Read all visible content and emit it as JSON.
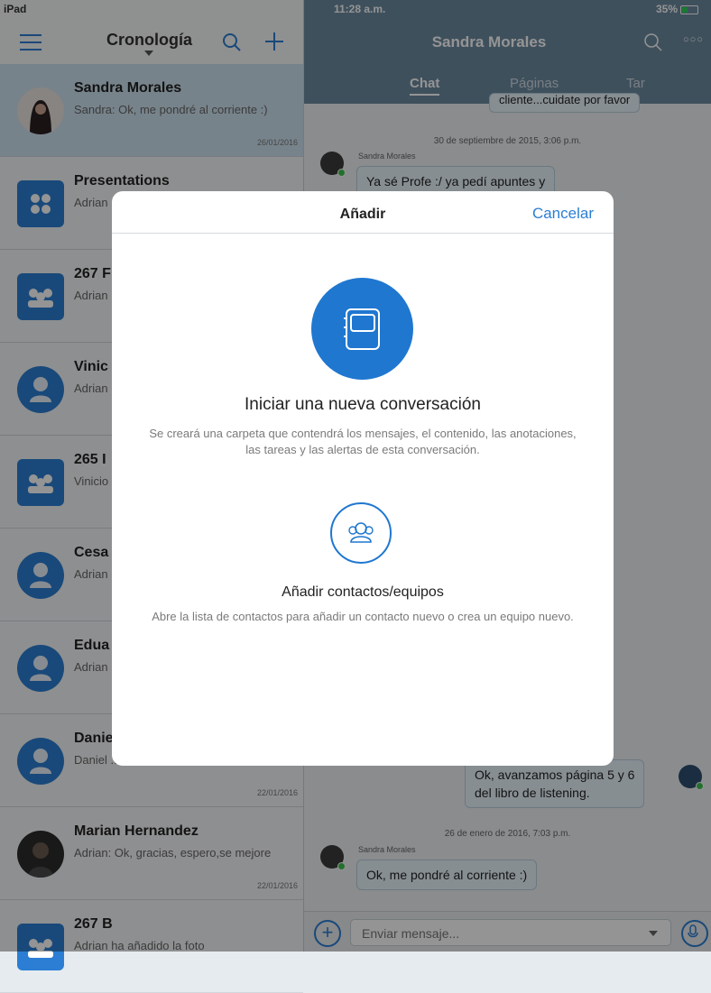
{
  "status_bar": {
    "device": "iPad",
    "time": "11:28 a.m.",
    "battery": "35%"
  },
  "left_pane": {
    "title": "Cronología",
    "items": [
      {
        "title": "Sandra Morales",
        "text": "Sandra: Ok, me pondré al corriente :)",
        "date": "26/01/2016"
      },
      {
        "title": "Presentations",
        "text": "Adrian ... \"26/01...",
        "date": ""
      },
      {
        "title": "267 F",
        "text": "Adrian ... archiv...",
        "date": ""
      },
      {
        "title": "Vinic",
        "text": "Adrian ...",
        "date": ""
      },
      {
        "title": "265 I",
        "text": "Vinicio ... no lleg...",
        "date": ""
      },
      {
        "title": "Cesa",
        "text": "Adrian ...",
        "date": ""
      },
      {
        "title": "Edua",
        "text": "Adrian ... tienes...",
        "date": ""
      },
      {
        "title": "Danie",
        "text": "Daniel ... buscaré rutas alternas",
        "date": "22/01/2016"
      },
      {
        "title": "Marian Hernandez",
        "text": "Adrian: Ok, gracias, espero,se mejore",
        "date": "22/01/2016"
      },
      {
        "title": "267 B",
        "text": "Adrian ha añadido la foto",
        "date": ""
      }
    ]
  },
  "right_pane": {
    "title": "Sandra Morales",
    "tabs": [
      "Chat",
      "Páginas",
      "Tar"
    ],
    "messages": {
      "top_partial": "cliente...cuidate por favor",
      "date1": "30 de septiembre de 2015, 3:06 p.m.",
      "sender1": "Sandra Morales",
      "msg1": "Ya sé Profe :/ ya pedí apuntes y",
      "msg2_line1": "Ok, avanzamos página 5 y 6",
      "msg2_line2": "del libro de listening.",
      "date2": "26 de enero de 2016, 7:03 p.m.",
      "sender2": "Sandra Morales",
      "msg3": "Ok, me pondré al corriente :)"
    },
    "composer_placeholder": "Enviar mensaje..."
  },
  "modal": {
    "title": "Añadir",
    "cancel": "Cancelar",
    "option1": {
      "title": "Iniciar una nueva conversación",
      "desc": "Se creará una carpeta que contendrá los mensajes, el contenido, las anotaciones, las tareas y las alertas de esta conversación."
    },
    "option2": {
      "title": "Añadir contactos/equipos",
      "desc": "Abre la lista de contactos para añadir un contacto nuevo o crea un equipo nuevo."
    }
  },
  "colors": {
    "accent": "#2b7ed3",
    "header": "#6d8aa0",
    "selected": "#cde2ef"
  }
}
